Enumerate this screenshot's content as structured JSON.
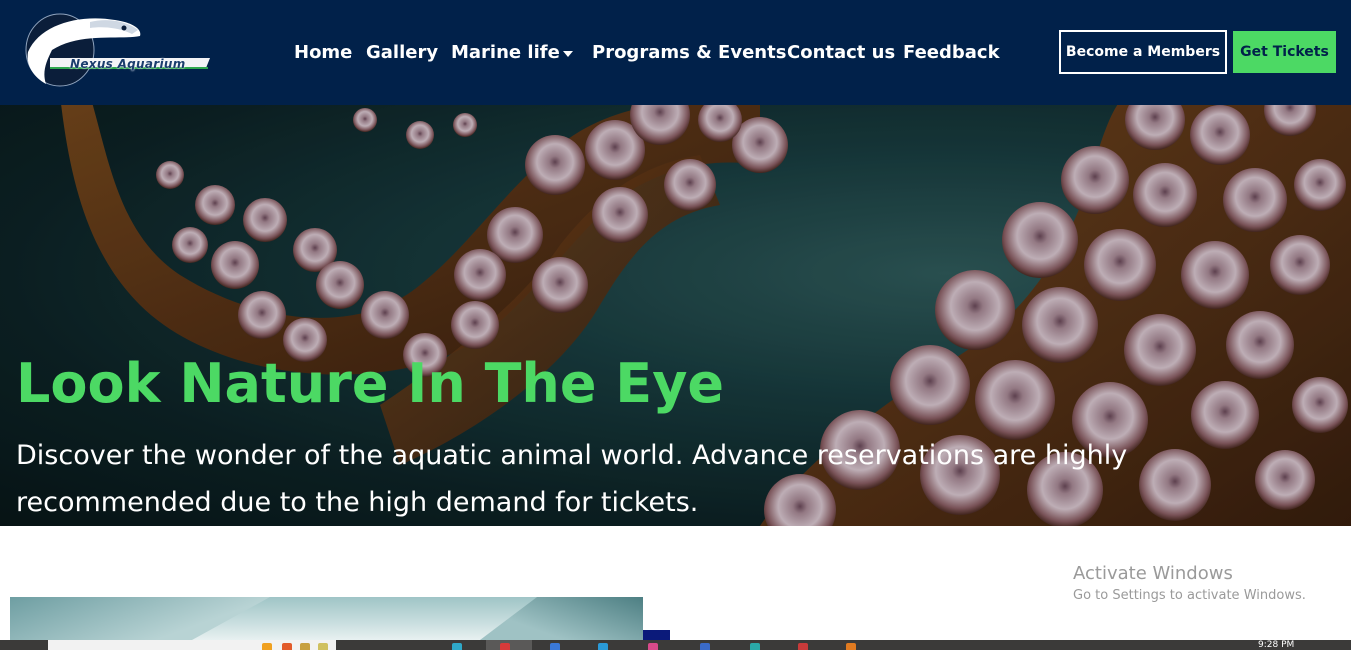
{
  "nav": {
    "logo_text": "Nexus Aquarium",
    "links": [
      {
        "label": "Home"
      },
      {
        "label": "Gallery"
      },
      {
        "label": "Marine life"
      },
      {
        "label": "Programs & Events"
      },
      {
        "label": "Contact us"
      },
      {
        "label": "Feedback"
      }
    ],
    "become_member_label": "Become a Members",
    "get_tickets_label": "Get Tickets"
  },
  "hero": {
    "title": "Look Nature In The Eye",
    "description": "Discover the wonder of the aquatic animal world. Advance reservations are highly recommended due to the high demand for tickets."
  },
  "watermark": {
    "title": "Activate Windows",
    "subtitle": "Go to Settings to activate Windows."
  },
  "taskbar": {
    "time": "9:28 PM"
  },
  "colors": {
    "nav_bg": "#01214a",
    "accent_green": "#4cd964",
    "text_white": "#ffffff"
  },
  "icons": [
    "logo-fish-icon",
    "chevron-down-icon"
  ]
}
